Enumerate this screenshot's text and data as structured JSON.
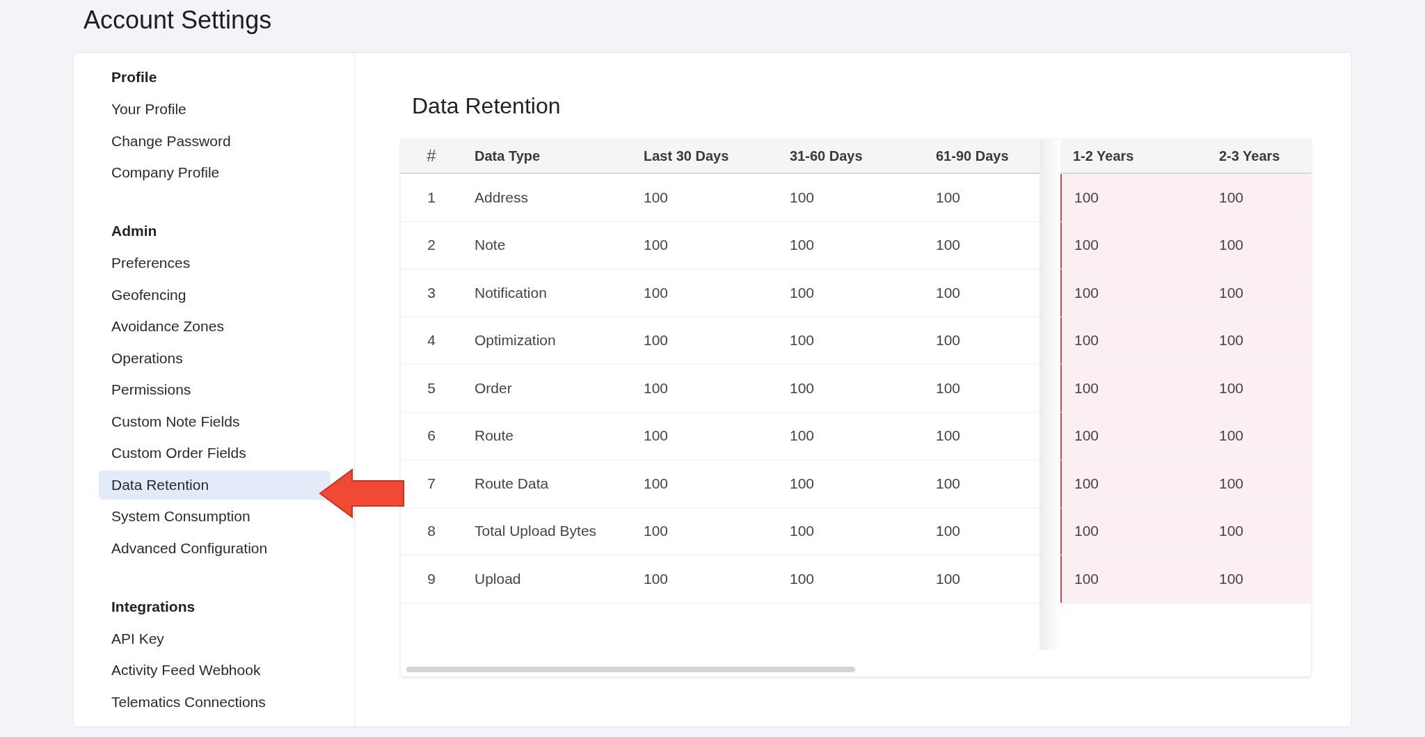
{
  "page_title": "Account Settings",
  "sidebar": {
    "sections": [
      {
        "heading": "Profile",
        "items": [
          {
            "label": "Your Profile",
            "selected": false
          },
          {
            "label": "Change Password",
            "selected": false
          },
          {
            "label": "Company Profile",
            "selected": false
          }
        ]
      },
      {
        "heading": "Admin",
        "items": [
          {
            "label": "Preferences",
            "selected": false
          },
          {
            "label": "Geofencing",
            "selected": false
          },
          {
            "label": "Avoidance Zones",
            "selected": false
          },
          {
            "label": "Operations",
            "selected": false
          },
          {
            "label": "Permissions",
            "selected": false
          },
          {
            "label": "Custom Note Fields",
            "selected": false
          },
          {
            "label": "Custom Order Fields",
            "selected": false
          },
          {
            "label": "Data Retention",
            "selected": true
          },
          {
            "label": "System Consumption",
            "selected": false
          },
          {
            "label": "Advanced Configuration",
            "selected": false
          }
        ]
      },
      {
        "heading": "Integrations",
        "items": [
          {
            "label": "API Key",
            "selected": false
          },
          {
            "label": "Activity Feed Webhook",
            "selected": false
          },
          {
            "label": "Telematics Connections",
            "selected": false
          }
        ]
      }
    ]
  },
  "content": {
    "title": "Data Retention",
    "table": {
      "columns": [
        {
          "label": "#",
          "highlighted": false
        },
        {
          "label": "Data Type",
          "highlighted": false
        },
        {
          "label": "Last 30 Days",
          "highlighted": false
        },
        {
          "label": "31-60 Days",
          "highlighted": false
        },
        {
          "label": "61-90 Days",
          "highlighted": false
        },
        {
          "label": "1-2 Years",
          "highlighted": true
        },
        {
          "label": "2-3 Years",
          "highlighted": true
        }
      ],
      "rows": [
        [
          "1",
          "Address",
          "100",
          "100",
          "100",
          "100",
          "100"
        ],
        [
          "2",
          "Note",
          "100",
          "100",
          "100",
          "100",
          "100"
        ],
        [
          "3",
          "Notification",
          "100",
          "100",
          "100",
          "100",
          "100"
        ],
        [
          "4",
          "Optimization",
          "100",
          "100",
          "100",
          "100",
          "100"
        ],
        [
          "5",
          "Order",
          "100",
          "100",
          "100",
          "100",
          "100"
        ],
        [
          "6",
          "Route",
          "100",
          "100",
          "100",
          "100",
          "100"
        ],
        [
          "7",
          "Route Data",
          "100",
          "100",
          "100",
          "100",
          "100"
        ],
        [
          "8",
          "Total Upload Bytes",
          "100",
          "100",
          "100",
          "100",
          "100"
        ],
        [
          "9",
          "Upload",
          "100",
          "100",
          "100",
          "100",
          "100"
        ]
      ]
    }
  }
}
